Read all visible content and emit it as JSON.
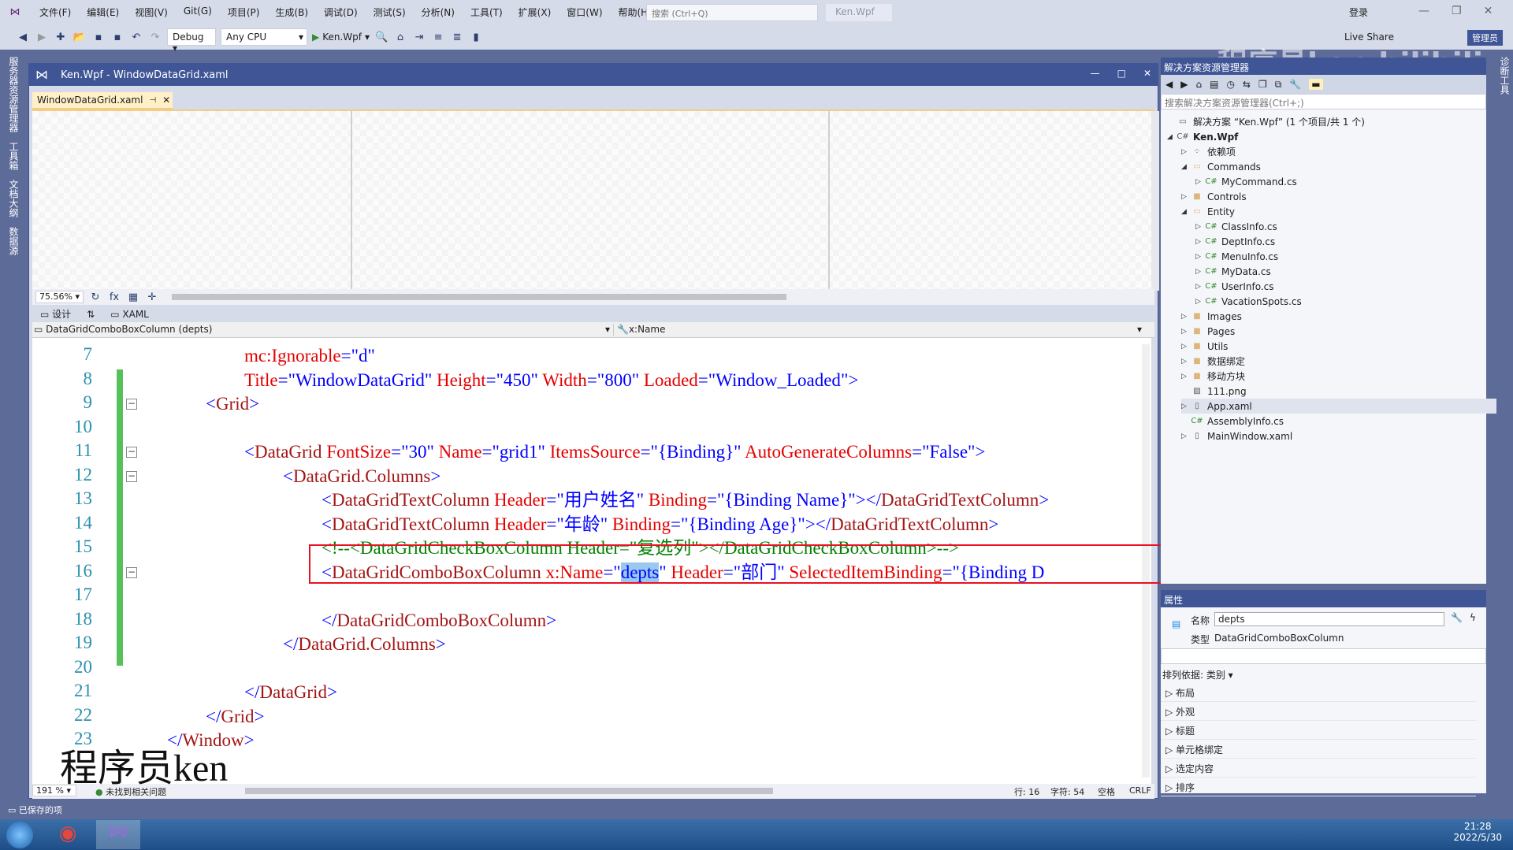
{
  "menubar": {
    "items": [
      "文件(F)",
      "编辑(E)",
      "视图(V)",
      "Git(G)",
      "项目(P)",
      "生成(B)",
      "调试(D)",
      "测试(S)",
      "分析(N)",
      "工具(T)",
      "扩展(X)",
      "窗口(W)",
      "帮助(H)"
    ],
    "search_placeholder": "搜索 (Ctrl+Q)",
    "solution_title": "Ken.Wpf",
    "login": "登录",
    "live_share": "Live Share",
    "admin": "管理员"
  },
  "toolbar": {
    "config": "Debug",
    "platform": "Any CPU",
    "start": "Ken.Wpf"
  },
  "left_strip": [
    "服务器资源管理器",
    "工具箱",
    "文档大纲",
    "数据源"
  ],
  "right_strip": [
    "诊断工具"
  ],
  "document": {
    "window_title": "Ken.Wpf - WindowDataGrid.xaml",
    "tab": "WindowDataGrid.xaml",
    "zoom": "75.56%",
    "view_tabs": [
      "设计",
      "XAML"
    ],
    "nav_left": "DataGridComboBoxColumn (depts)",
    "nav_right": "x:Name"
  },
  "code": [
    {
      "n": "7",
      "ind": 2,
      "t": [
        [
          "attr",
          "mc:Ignorable"
        ],
        [
          "text",
          "=\""
        ],
        [
          "val",
          "d"
        ],
        [
          "text",
          "\""
        ]
      ]
    },
    {
      "n": "8",
      "ind": 2,
      "t": [
        [
          "attr",
          "Title"
        ],
        [
          "text",
          "=\""
        ],
        [
          "val",
          "WindowDataGrid"
        ],
        [
          "text",
          "\" "
        ],
        [
          "attr",
          "Height"
        ],
        [
          "text",
          "=\""
        ],
        [
          "val",
          "450"
        ],
        [
          "text",
          "\" "
        ],
        [
          "attr",
          "Width"
        ],
        [
          "text",
          "=\""
        ],
        [
          "val",
          "800"
        ],
        [
          "text",
          "\" "
        ],
        [
          "attr",
          "Loaded"
        ],
        [
          "text",
          "=\""
        ],
        [
          "val",
          "Window_Loaded"
        ],
        [
          "text",
          "\">"
        ]
      ]
    },
    {
      "n": "9",
      "ind": 1,
      "fold": true,
      "t": [
        [
          "text",
          "<"
        ],
        [
          "tag",
          "Grid"
        ],
        [
          "text",
          ">"
        ]
      ]
    },
    {
      "n": "10",
      "ind": 0,
      "t": []
    },
    {
      "n": "11",
      "ind": 2,
      "fold": true,
      "t": [
        [
          "text",
          "<"
        ],
        [
          "tag",
          "DataGrid "
        ],
        [
          "attr",
          "FontSize"
        ],
        [
          "text",
          "=\""
        ],
        [
          "val",
          "30"
        ],
        [
          "text",
          "\" "
        ],
        [
          "attr",
          "Name"
        ],
        [
          "text",
          "=\""
        ],
        [
          "val",
          "grid1"
        ],
        [
          "text",
          "\" "
        ],
        [
          "attr",
          "ItemsSource"
        ],
        [
          "text",
          "=\""
        ],
        [
          "val",
          "{Binding}"
        ],
        [
          "text",
          "\" "
        ],
        [
          "attr",
          "AutoGenerateColumns"
        ],
        [
          "text",
          "=\""
        ],
        [
          "val",
          "False"
        ],
        [
          "text",
          "\">"
        ]
      ]
    },
    {
      "n": "12",
      "ind": 3,
      "fold": true,
      "t": [
        [
          "text",
          "<"
        ],
        [
          "tag",
          "DataGrid.Columns"
        ],
        [
          "text",
          ">"
        ]
      ]
    },
    {
      "n": "13",
      "ind": 4,
      "t": [
        [
          "text",
          "<"
        ],
        [
          "tag",
          "DataGridTextColumn "
        ],
        [
          "attr",
          "Header"
        ],
        [
          "text",
          "=\""
        ],
        [
          "val",
          "用户姓名"
        ],
        [
          "text",
          "\" "
        ],
        [
          "attr",
          "Binding"
        ],
        [
          "text",
          "=\""
        ],
        [
          "val",
          "{Binding Name}"
        ],
        [
          "text",
          "\"></"
        ],
        [
          "tag",
          "DataGridTextColumn"
        ],
        [
          "text",
          ">"
        ]
      ]
    },
    {
      "n": "14",
      "ind": 4,
      "t": [
        [
          "text",
          "<"
        ],
        [
          "tag",
          "DataGridTextColumn "
        ],
        [
          "attr",
          "Header"
        ],
        [
          "text",
          "=\""
        ],
        [
          "val",
          "年龄"
        ],
        [
          "text",
          "\" "
        ],
        [
          "attr",
          "Binding"
        ],
        [
          "text",
          "=\""
        ],
        [
          "val",
          "{Binding Age}"
        ],
        [
          "text",
          "\"></"
        ],
        [
          "tag",
          "DataGridTextColumn"
        ],
        [
          "text",
          ">"
        ]
      ]
    },
    {
      "n": "15",
      "ind": 4,
      "t": [
        [
          "cmt",
          "<!--<DataGridCheckBoxColumn Header=\"复选列\"></DataGridCheckBoxColumn>-->"
        ]
      ]
    },
    {
      "n": "16",
      "ind": 4,
      "fold": true,
      "t": [
        [
          "text",
          "<"
        ],
        [
          "tag",
          "DataGridComboBoxColumn "
        ],
        [
          "attr",
          "x:Name"
        ],
        [
          "text",
          "=\""
        ],
        [
          "sel",
          "depts"
        ],
        [
          "text",
          "\" "
        ],
        [
          "attr",
          "Header"
        ],
        [
          "text",
          "=\""
        ],
        [
          "val",
          "部门"
        ],
        [
          "text",
          "\" "
        ],
        [
          "attr",
          "SelectedItemBinding"
        ],
        [
          "text",
          "=\""
        ],
        [
          "val",
          "{Binding D"
        ]
      ]
    },
    {
      "n": "17",
      "ind": 0,
      "t": []
    },
    {
      "n": "18",
      "ind": 4,
      "t": [
        [
          "text",
          "</"
        ],
        [
          "tag",
          "DataGridComboBoxColumn"
        ],
        [
          "text",
          ">"
        ]
      ]
    },
    {
      "n": "19",
      "ind": 3,
      "t": [
        [
          "text",
          "</"
        ],
        [
          "tag",
          "DataGrid.Columns"
        ],
        [
          "text",
          ">"
        ]
      ]
    },
    {
      "n": "20",
      "ind": 0,
      "t": []
    },
    {
      "n": "21",
      "ind": 2,
      "t": [
        [
          "text",
          "</"
        ],
        [
          "tag",
          "DataGrid"
        ],
        [
          "text",
          ">"
        ]
      ]
    },
    {
      "n": "22",
      "ind": 1,
      "t": [
        [
          "text",
          "</"
        ],
        [
          "tag",
          "Grid"
        ],
        [
          "text",
          ">"
        ]
      ]
    },
    {
      "n": "23",
      "ind": 0,
      "t": [
        [
          "text",
          "</"
        ],
        [
          "tag",
          "Window"
        ],
        [
          "text",
          ">"
        ]
      ]
    }
  ],
  "editor_status": {
    "zoom": "191 %",
    "issues": "未找到相关问题",
    "line": "行: 16",
    "char": "字符: 54",
    "spaces": "空格",
    "eol": "CRLF"
  },
  "status_bar": "已保存的项",
  "solution_explorer": {
    "title": "解决方案资源管理器",
    "search_placeholder": "搜索解决方案资源管理器(Ctrl+;)",
    "items": [
      {
        "label": "解决方案 “Ken.Wpf” (1 个项目/共 1 个)",
        "depth": 0,
        "icon": "solution-icon",
        "arrow": ""
      },
      {
        "label": "Ken.Wpf",
        "depth": 0,
        "icon": "csproj-icon",
        "arrow": "open",
        "bold": true
      },
      {
        "label": "依赖项",
        "depth": 1,
        "icon": "dependencies-icon",
        "arrow": "closed"
      },
      {
        "label": "Commands",
        "depth": 1,
        "icon": "folder-open-icon",
        "arrow": "open"
      },
      {
        "label": "MyCommand.cs",
        "depth": 2,
        "icon": "csharp-file-icon",
        "arrow": "closed"
      },
      {
        "label": "Controls",
        "depth": 1,
        "icon": "folder-icon",
        "arrow": "closed"
      },
      {
        "label": "Entity",
        "depth": 1,
        "icon": "folder-open-icon",
        "arrow": "open"
      },
      {
        "label": "ClassInfo.cs",
        "depth": 2,
        "icon": "csharp-file-icon",
        "arrow": "closed"
      },
      {
        "label": "DeptInfo.cs",
        "depth": 2,
        "icon": "csharp-file-icon",
        "arrow": "closed"
      },
      {
        "label": "MenuInfo.cs",
        "depth": 2,
        "icon": "csharp-file-icon",
        "arrow": "closed"
      },
      {
        "label": "MyData.cs",
        "depth": 2,
        "icon": "csharp-file-icon",
        "arrow": "closed"
      },
      {
        "label": "UserInfo.cs",
        "depth": 2,
        "icon": "csharp-file-icon",
        "arrow": "closed"
      },
      {
        "label": "VacationSpots.cs",
        "depth": 2,
        "icon": "csharp-file-icon",
        "arrow": "closed"
      },
      {
        "label": "Images",
        "depth": 1,
        "icon": "folder-icon",
        "arrow": "closed"
      },
      {
        "label": "Pages",
        "depth": 1,
        "icon": "folder-icon",
        "arrow": "closed"
      },
      {
        "label": "Utils",
        "depth": 1,
        "icon": "folder-icon",
        "arrow": "closed"
      },
      {
        "label": "数据绑定",
        "depth": 1,
        "icon": "folder-icon",
        "arrow": "closed"
      },
      {
        "label": "移动方块",
        "depth": 1,
        "icon": "folder-icon",
        "arrow": "closed"
      },
      {
        "label": "111.png",
        "depth": 1,
        "icon": "image-file-icon",
        "arrow": ""
      },
      {
        "label": "App.xaml",
        "depth": 1,
        "icon": "xaml-file-icon",
        "arrow": "closed",
        "selected": true
      },
      {
        "label": "AssemblyInfo.cs",
        "depth": 1,
        "icon": "csharp-file-icon",
        "arrow": ""
      },
      {
        "label": "MainWindow.xaml",
        "depth": 1,
        "icon": "xaml-file-icon",
        "arrow": "closed"
      }
    ]
  },
  "properties": {
    "title": "属性",
    "name_label": "名称",
    "name_value": "depts",
    "type_label": "类型",
    "type_value": "DataGridComboBoxColumn",
    "sort": "排列依据: 类别 ▾",
    "categories": [
      "布局",
      "外观",
      "标题",
      "单元格绑定",
      "选定内容",
      "排序"
    ]
  },
  "taskbar": {
    "time": "21:28",
    "date": "2022/5/30"
  },
  "watermark": {
    "text": "程序员ken",
    "top": "程序员ken bilibili"
  }
}
